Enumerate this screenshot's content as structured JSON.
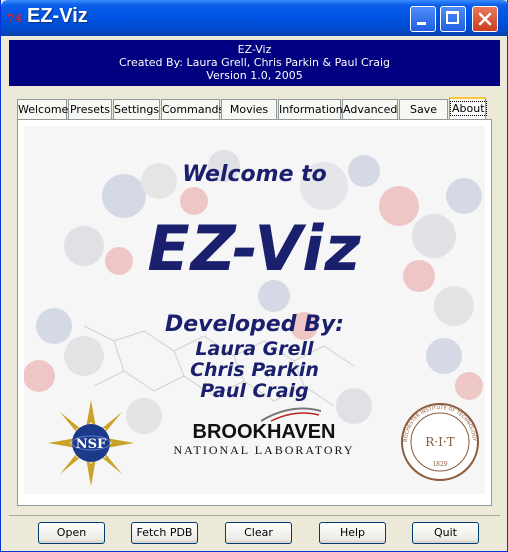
{
  "window": {
    "title": "EZ-Viz",
    "icon_label": "74"
  },
  "header": {
    "line1": "EZ-Viz",
    "line2": "Created By: Laura Grell, Chris Parkin & Paul Craig",
    "line3": "Version 1.0, 2005"
  },
  "tabs": [
    {
      "label": "Welcome"
    },
    {
      "label": "Presets"
    },
    {
      "label": "Settings"
    },
    {
      "label": "Commands"
    },
    {
      "label": "Movies"
    },
    {
      "label": "Information"
    },
    {
      "label": "Advanced"
    },
    {
      "label": "Save"
    },
    {
      "label": "About"
    }
  ],
  "active_tab": "About",
  "welcome": {
    "welcome_to": "Welcome to",
    "app_name": "EZ-Viz",
    "developed_by": "Developed By:",
    "developers": [
      "Laura Grell",
      "Chris Parkin",
      "Paul Craig"
    ]
  },
  "logos": {
    "nsf": "NSF",
    "bnl_main": "BROOKHAVEN",
    "bnl_sub": "NATIONAL LABORATORY",
    "rit_center": "R·I·T",
    "rit_ring": "ROCHESTER INSTITUTE OF TECHNOLOGY",
    "rit_year": "1829"
  },
  "buttons": {
    "open": "Open",
    "fetch_pdb": "Fetch PDB",
    "clear": "Clear",
    "help": "Help",
    "quit": "Quit"
  },
  "colors": {
    "title_bar": "#0054e3",
    "header_bg": "#000080",
    "welcome_text": "#1a1f6e"
  }
}
